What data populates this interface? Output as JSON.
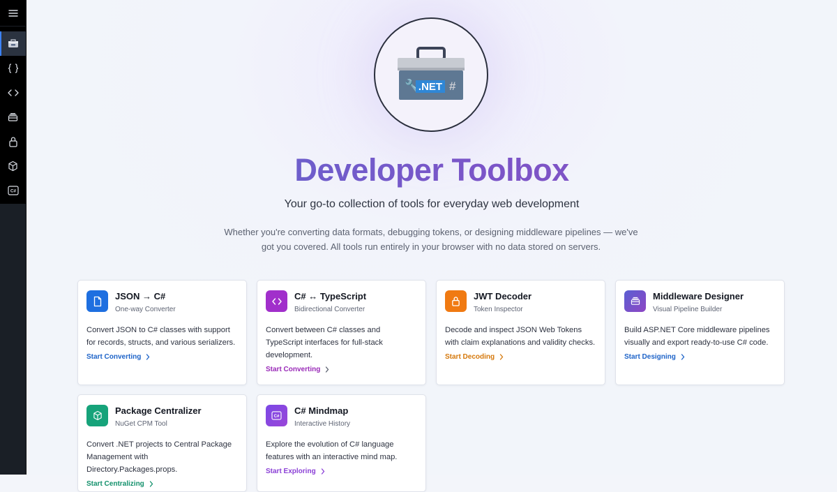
{
  "hero": {
    "logo_badge": ".NET",
    "title": "Developer Toolbox",
    "subtitle": "Your go-to collection of tools for everyday web development",
    "description": "Whether you're converting data formats, debugging tokens, or designing middleware pipelines — we've got you covered. All tools run entirely in your browser with no data stored on servers."
  },
  "sidebar": {
    "items": [
      {
        "icon": "toolbox-icon",
        "active": true
      },
      {
        "icon": "braces-icon"
      },
      {
        "icon": "code-icon"
      },
      {
        "icon": "layers-icon"
      },
      {
        "icon": "lock-icon"
      },
      {
        "icon": "package-icon"
      },
      {
        "icon": "csharp-icon",
        "badge": "C#"
      }
    ]
  },
  "cards": [
    {
      "title": "JSON → C#",
      "subtitle": "One-way Converter",
      "description": "Convert JSON to C# classes with support for records, structs, and various serializers.",
      "link": "Start Converting",
      "color": "#1e6fe0",
      "icon": "file-icon"
    },
    {
      "title": "C# ↔ TypeScript",
      "subtitle": "Bidirectional Converter",
      "description": "Convert between C# classes and TypeScript interfaces for full-stack development.",
      "link": "Start Converting",
      "color": "#a12fcb",
      "icon": "code-icon"
    },
    {
      "title": "JWT Decoder",
      "subtitle": "Token Inspector",
      "description": "Decode and inspect JSON Web Tokens with claim explanations and validity checks.",
      "link": "Start Decoding",
      "color": "#e2760e",
      "icon": "lock-icon"
    },
    {
      "title": "Middleware Designer",
      "subtitle": "Visual Pipeline Builder",
      "description": "Build ASP.NET Core middleware pipelines visually and export ready-to-use C# code.",
      "link": "Start Designing",
      "color": "#7a4bc8",
      "icon": "layers-icon"
    },
    {
      "title": "Package Centralizer",
      "subtitle": "NuGet CPM Tool",
      "description": "Convert .NET projects to Central Package Management with Directory.Packages.props.",
      "link": "Start Centralizing",
      "color": "#16a37a",
      "icon": "package-icon"
    },
    {
      "title": "C# Mindmap",
      "subtitle": "Interactive History",
      "description": "Explore the evolution of C# language features with an interactive mind map.",
      "link": "Start Exploring",
      "color": "#8a44e0",
      "icon": "csharp-icon",
      "badge": "C#"
    }
  ],
  "link_colors": [
    "#1d63c8",
    "#9a2bb8",
    "#d5780b",
    "#1d63c8",
    "#12906b",
    "#8a3fd6"
  ]
}
